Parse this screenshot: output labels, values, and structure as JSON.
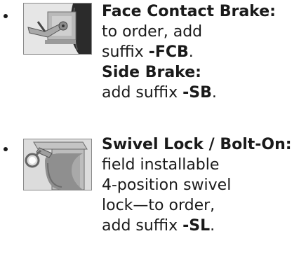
{
  "items": [
    {
      "image_icon": "brake-caster-photo",
      "lines": [
        {
          "text": "Face Contact Brake:",
          "bold": true
        },
        {
          "text": "to order, add"
        },
        {
          "prefix": "suffix ",
          "code": "-FCB",
          "suffix": "."
        },
        {
          "text": "Side Brake:",
          "bold": true
        },
        {
          "prefix": "add suffix ",
          "code": "-SB",
          "suffix": "."
        }
      ]
    },
    {
      "image_icon": "swivel-lock-caster-photo",
      "lines": [
        {
          "text": "Swivel Lock / Bolt-On:",
          "bold": true
        },
        {
          "text": "field installable"
        },
        {
          "text": "4-position swivel"
        },
        {
          "text": "lock—to order,"
        },
        {
          "prefix": "add suffix ",
          "code": "-SL",
          "suffix": "."
        }
      ]
    }
  ],
  "colors": {
    "text": "#1a1a1a",
    "thumb_border": "#8a8a8a"
  }
}
